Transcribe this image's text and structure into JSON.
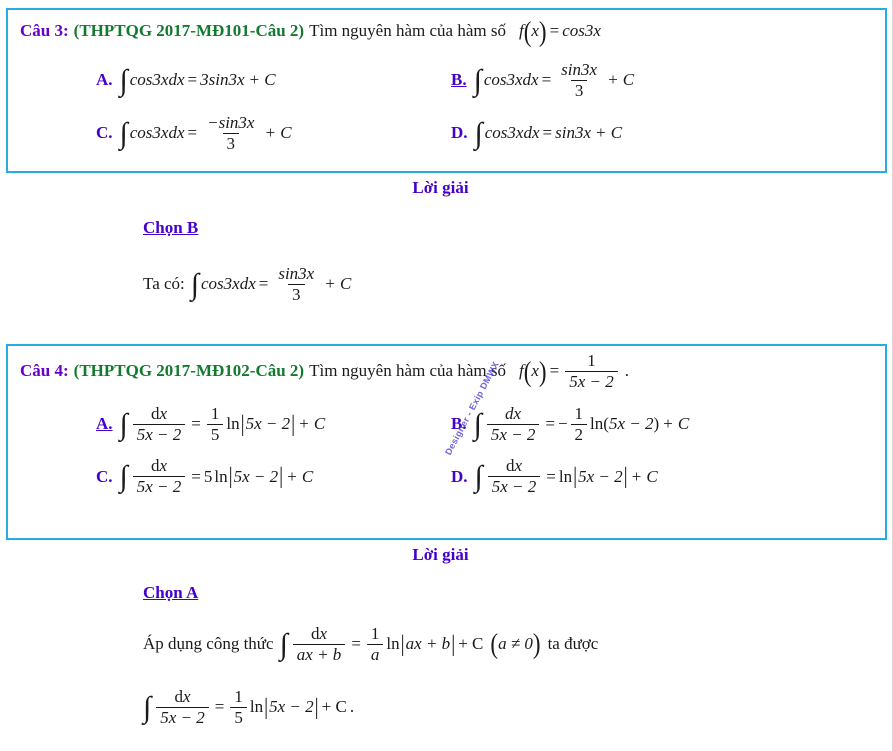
{
  "document": {
    "language": "vi",
    "colors": {
      "question_number": "#6600CC",
      "source_tag": "#127A2E",
      "option_label": "#4400CC",
      "solution_heading": "#4400CC",
      "box_border": "#29ABE2",
      "body_text": "#1a1a1a",
      "watermark": "#3b2fd8"
    }
  },
  "watermark": {
    "text": "Designer - Exip DMWX"
  },
  "questions": [
    {
      "number_label": "Câu 3:",
      "source_label": "(THPTQG 2017-MĐ101-Câu 2)",
      "prompt_text": "Tìm nguyên hàm của hàm số",
      "function": {
        "name": "f",
        "variable": "x",
        "equals": "=",
        "expression": "cos3x"
      },
      "options": [
        {
          "label": "A.",
          "correct": false,
          "integrand": "cos3xdx",
          "result_type": "plain",
          "result": "3sin3x",
          "constant": "+ C"
        },
        {
          "label": "B.",
          "correct": true,
          "integrand": "cos3xdx",
          "result_type": "fraction",
          "numerator": "sin3x",
          "denominator": "3",
          "constant": "+ C"
        },
        {
          "label": "C.",
          "correct": false,
          "integrand": "cos3xdx",
          "result_type": "fraction",
          "numerator": "−sin3x",
          "denominator": "3",
          "constant": "+ C"
        },
        {
          "label": "D.",
          "correct": false,
          "integrand": "cos3xdx",
          "result_type": "plain",
          "result": "sin3x",
          "constant": "+ C"
        }
      ],
      "solution": {
        "heading": "Lời giải",
        "choose": "Chọn B",
        "lines": [
          {
            "lead": "Ta có:",
            "integrand": "cos3xdx",
            "numerator": "sin3x",
            "denominator": "3",
            "constant": "+ C"
          }
        ]
      }
    },
    {
      "number_label": "Câu 4:",
      "source_label": "(THPTQG 2017-MĐ102-Câu 2)",
      "prompt_text": "Tìm nguyên hàm của hàm số",
      "function": {
        "name": "f",
        "variable": "x",
        "equals": "=",
        "numerator": "1",
        "denominator": "5x − 2",
        "trailing": "."
      },
      "options": [
        {
          "label": "A.",
          "correct": true,
          "int_numerator": "dx",
          "int_denominator": "5x − 2",
          "coef_numerator": "1",
          "coef_denominator": "5",
          "log_text": "ln",
          "arg_open": "|",
          "arg": "5x − 2",
          "arg_close": "|",
          "constant": "+ C"
        },
        {
          "label": "B.",
          "correct": false,
          "int_numerator": "dx",
          "int_denominator": "5x − 2",
          "sign": "−",
          "coef_numerator": "1",
          "coef_denominator": "2",
          "log_text": "ln",
          "arg_open": "(",
          "arg": "5x − 2",
          "arg_close": ")",
          "constant": "+ C"
        },
        {
          "label": "C.",
          "correct": false,
          "int_numerator": "dx",
          "int_denominator": "5x − 2",
          "scalar": "5",
          "log_text": "ln",
          "arg_open": "|",
          "arg": "5x − 2",
          "arg_close": "|",
          "constant": "+ C"
        },
        {
          "label": "D.",
          "correct": false,
          "int_numerator": "dx",
          "int_denominator": "5x − 2",
          "log_text": "ln",
          "arg_open": "|",
          "arg": "5x − 2",
          "arg_close": "|",
          "constant": "+ C"
        }
      ],
      "solution": {
        "heading": "Lời giải",
        "choose": "Chọn A",
        "formula_line": {
          "lead": "Áp dụng công thức",
          "int_numerator": "dx",
          "int_denominator": "ax + b",
          "coef_numerator": "1",
          "coef_denominator": "a",
          "log_text": "ln",
          "arg": "ax + b",
          "constant": "+ C",
          "condition": "a ≠ 0",
          "tail": "ta được"
        },
        "result_line": {
          "int_numerator": "dx",
          "int_denominator": "5x − 2",
          "coef_numerator": "1",
          "coef_denominator": "5",
          "log_text": "ln",
          "arg": "5x − 2",
          "constant": "+ C",
          "trailing": "."
        }
      }
    }
  ]
}
